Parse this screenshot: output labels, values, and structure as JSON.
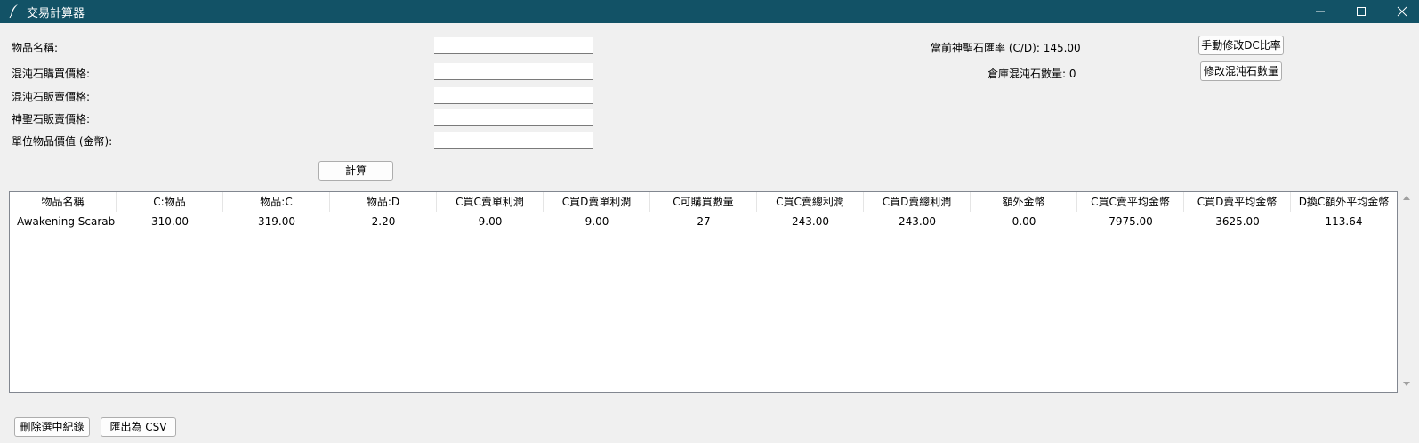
{
  "window": {
    "title": "交易計算器",
    "icon": "feather-icon",
    "controls": [
      "minimize-icon",
      "maximize-icon",
      "close-icon"
    ]
  },
  "form": {
    "fields": [
      {
        "label": "物品名稱:",
        "value": ""
      },
      {
        "label": "混沌石購買價格:",
        "value": ""
      },
      {
        "label": "混沌石販賣價格:",
        "value": ""
      },
      {
        "label": "神聖石販賣價格:",
        "value": ""
      },
      {
        "label": "單位物品價值 (金幣):",
        "value": ""
      }
    ],
    "calculate_button": "計算"
  },
  "status": {
    "rate_text": "當前神聖石匯率 (C/D): 145.00",
    "stock_text": "倉庫混沌石數量: 0",
    "edit_rate_button": "手動修改DC比率",
    "edit_stock_button": "修改混沌石數量"
  },
  "table": {
    "columns": [
      "物品名稱",
      "C:物品",
      "物品:C",
      "物品:D",
      "C買C賣單利潤",
      "C買D賣單利潤",
      "C可購買數量",
      "C買C賣總利潤",
      "C買D賣總利潤",
      "額外金幣",
      "C買C賣平均金幣",
      "C買D賣平均金幣",
      "D換C額外平均金幣"
    ],
    "rows": [
      [
        "Awakening Scarab",
        "310.00",
        "319.00",
        "2.20",
        "9.00",
        "9.00",
        "27",
        "243.00",
        "243.00",
        "0.00",
        "7975.00",
        "3625.00",
        "113.64"
      ]
    ]
  },
  "bottom": {
    "delete_button": "刪除選中紀錄",
    "export_button": "匯出為 CSV"
  },
  "colors": {
    "titlebar": "#125266",
    "window_bg": "#f0f0f0",
    "table_bg": "#ffffff"
  }
}
